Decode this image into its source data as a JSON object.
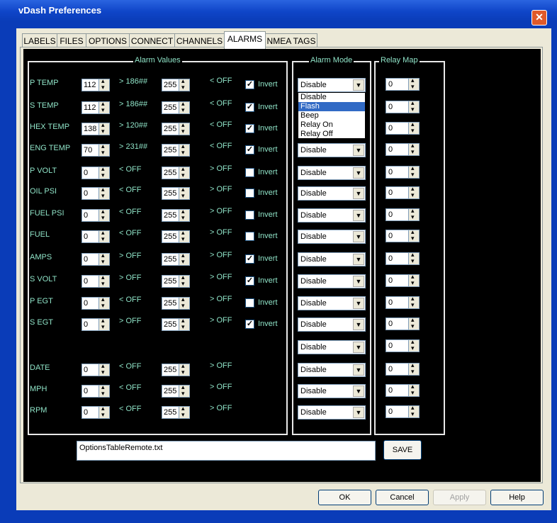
{
  "window": {
    "title": "vDash Preferences"
  },
  "tabs": [
    {
      "label": "LABELS"
    },
    {
      "label": "FILES"
    },
    {
      "label": "OPTIONS"
    },
    {
      "label": "CONNECT"
    },
    {
      "label": "CHANNELS"
    },
    {
      "label": "ALARMS"
    },
    {
      "label": "NMEA TAGS"
    }
  ],
  "active_tab": "ALARMS",
  "groups": {
    "alarm_values": "Alarm Values",
    "alarm_mode": "Alarm Mode",
    "relay_map": "Relay Map"
  },
  "invert_label": "Invert",
  "rows": [
    {
      "name": "P TEMP",
      "v1": "112",
      "mid": "> 186##",
      "v2": "255",
      "end": "< OFF",
      "invert": true,
      "mode": "Disable",
      "relay": "0"
    },
    {
      "name": "S TEMP",
      "v1": "112",
      "mid": "> 186##",
      "v2": "255",
      "end": "< OFF",
      "invert": true,
      "mode": "",
      "relay": "0"
    },
    {
      "name": "HEX TEMP",
      "v1": "138",
      "mid": "> 120##",
      "v2": "255",
      "end": "< OFF",
      "invert": true,
      "mode": "",
      "relay": "0"
    },
    {
      "name": "ENG TEMP",
      "v1": "70",
      "mid": "> 231##",
      "v2": "255",
      "end": "< OFF",
      "invert": true,
      "mode": "Disable",
      "relay": "0"
    },
    {
      "name": "P VOLT",
      "v1": "0",
      "mid": "< OFF",
      "v2": "255",
      "end": "> OFF",
      "invert": false,
      "mode": "Disable",
      "relay": "0"
    },
    {
      "name": "OIL PSI",
      "v1": "0",
      "mid": "< OFF",
      "v2": "255",
      "end": "> OFF",
      "invert": false,
      "mode": "Disable",
      "relay": "0"
    },
    {
      "name": "FUEL PSI",
      "v1": "0",
      "mid": "< OFF",
      "v2": "255",
      "end": "> OFF",
      "invert": false,
      "mode": "Disable",
      "relay": "0"
    },
    {
      "name": "FUEL",
      "v1": "0",
      "mid": "< OFF",
      "v2": "255",
      "end": "> OFF",
      "invert": false,
      "mode": "Disable",
      "relay": "0"
    },
    {
      "name": "AMPS",
      "v1": "0",
      "mid": "> OFF",
      "v2": "255",
      "end": "> OFF",
      "invert": true,
      "mode": "Disable",
      "relay": "0"
    },
    {
      "name": "S VOLT",
      "v1": "0",
      "mid": "> OFF",
      "v2": "255",
      "end": "> OFF",
      "invert": true,
      "mode": "Disable",
      "relay": "0"
    },
    {
      "name": "P EGT",
      "v1": "0",
      "mid": "< OFF",
      "v2": "255",
      "end": "> OFF",
      "invert": false,
      "mode": "Disable",
      "relay": "0"
    },
    {
      "name": "S EGT",
      "v1": "0",
      "mid": "> OFF",
      "v2": "255",
      "end": "> OFF",
      "invert": true,
      "mode": "Disable",
      "relay": "0"
    }
  ],
  "extra_mode": {
    "mode": "Disable",
    "relay": "0"
  },
  "bottom_rows": [
    {
      "name": "DATE",
      "v1": "0",
      "mid": "< OFF",
      "v2": "255",
      "end": "> OFF",
      "mode": "Disable",
      "relay": "0"
    },
    {
      "name": "MPH",
      "v1": "0",
      "mid": "< OFF",
      "v2": "255",
      "end": "> OFF",
      "mode": "Disable",
      "relay": "0"
    },
    {
      "name": "RPM",
      "v1": "0",
      "mid": "< OFF",
      "v2": "255",
      "end": "> OFF",
      "mode": "Disable",
      "relay": "0"
    }
  ],
  "dropdown": {
    "options": [
      "Disable",
      "Flash",
      "Beep",
      "Relay On",
      "Relay Off"
    ],
    "highlighted": "Flash"
  },
  "file": {
    "value": "OptionsTableRemote.txt"
  },
  "save_label": "SAVE",
  "buttons": {
    "ok": "OK",
    "cancel": "Cancel",
    "apply": "Apply",
    "help": "Help"
  },
  "colors": {
    "label_text": "#8fe3c7",
    "panel_bg": "#000000",
    "titlebar": "#0f45c8"
  }
}
